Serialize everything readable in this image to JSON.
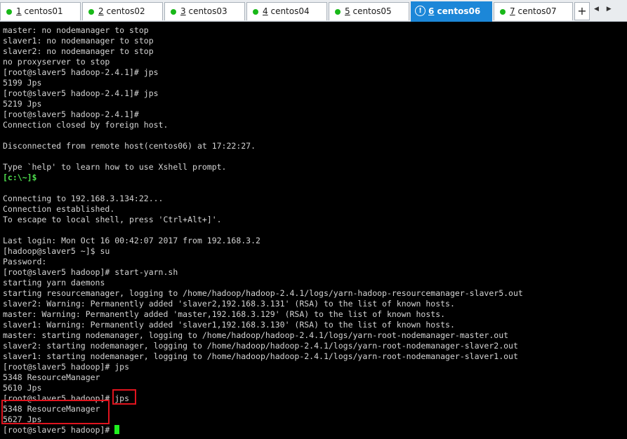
{
  "tabs": [
    {
      "num": "1",
      "label": "centos01",
      "active": false,
      "status": "connected"
    },
    {
      "num": "2",
      "label": "centos02",
      "active": false,
      "status": "connected"
    },
    {
      "num": "3",
      "label": "centos03",
      "active": false,
      "status": "connected"
    },
    {
      "num": "4",
      "label": "centos04",
      "active": false,
      "status": "connected"
    },
    {
      "num": "5",
      "label": "centos05",
      "active": false,
      "status": "connected"
    },
    {
      "num": "6",
      "label": "centos06",
      "active": true,
      "status": "warning"
    },
    {
      "num": "7",
      "label": "centos07",
      "active": false,
      "status": "connected"
    }
  ],
  "tabbar": {
    "new_tab_label": "+",
    "nav_arrows": "◀ ▶"
  },
  "colors": {
    "terminal_bg": "#000000",
    "terminal_fg": "#d4d4d4",
    "active_tab": "#1c87d8",
    "status_dot": "#18b818",
    "local_prompt": "#4ee04e",
    "cursor": "#1ff01f",
    "highlight_box": "#e0141e"
  },
  "terminal": {
    "lines": [
      "master: no nodemanager to stop",
      "slaver1: no nodemanager to stop",
      "slaver2: no nodemanager to stop",
      "no proxyserver to stop",
      "[root@slaver5 hadoop-2.4.1]# jps",
      "5199 Jps",
      "[root@slaver5 hadoop-2.4.1]# jps",
      "5219 Jps",
      "[root@slaver5 hadoop-2.4.1]#",
      "Connection closed by foreign host.",
      "",
      "Disconnected from remote host(centos06) at 17:22:27.",
      "",
      "Type `help' to learn how to use Xshell prompt.",
      "[c:\\~]$",
      "",
      "Connecting to 192.168.3.134:22...",
      "Connection established.",
      "To escape to local shell, press 'Ctrl+Alt+]'.",
      "",
      "Last login: Mon Oct 16 00:42:07 2017 from 192.168.3.2",
      "[hadoop@slaver5 ~]$ su",
      "Password:",
      "[root@slaver5 hadoop]# start-yarn.sh",
      "starting yarn daemons",
      "starting resourcemanager, logging to /home/hadoop/hadoop-2.4.1/logs/yarn-hadoop-resourcemanager-slaver5.out",
      "slaver2: Warning: Permanently added 'slaver2,192.168.3.131' (RSA) to the list of known hosts.",
      "master: Warning: Permanently added 'master,192.168.3.129' (RSA) to the list of known hosts.",
      "slaver1: Warning: Permanently added 'slaver1,192.168.3.130' (RSA) to the list of known hosts.",
      "master: starting nodemanager, logging to /home/hadoop/hadoop-2.4.1/logs/yarn-root-nodemanager-master.out",
      "slaver2: starting nodemanager, logging to /home/hadoop/hadoop-2.4.1/logs/yarn-root-nodemanager-slaver2.out",
      "slaver1: starting nodemanager, logging to /home/hadoop/hadoop-2.4.1/logs/yarn-root-nodemanager-slaver1.out",
      "[root@slaver5 hadoop]# jps",
      "5348 ResourceManager",
      "5610 Jps",
      "[root@slaver5 hadoop]# jps",
      "5348 ResourceManager",
      "5627 Jps",
      "[root@slaver5 hadoop]# "
    ]
  }
}
